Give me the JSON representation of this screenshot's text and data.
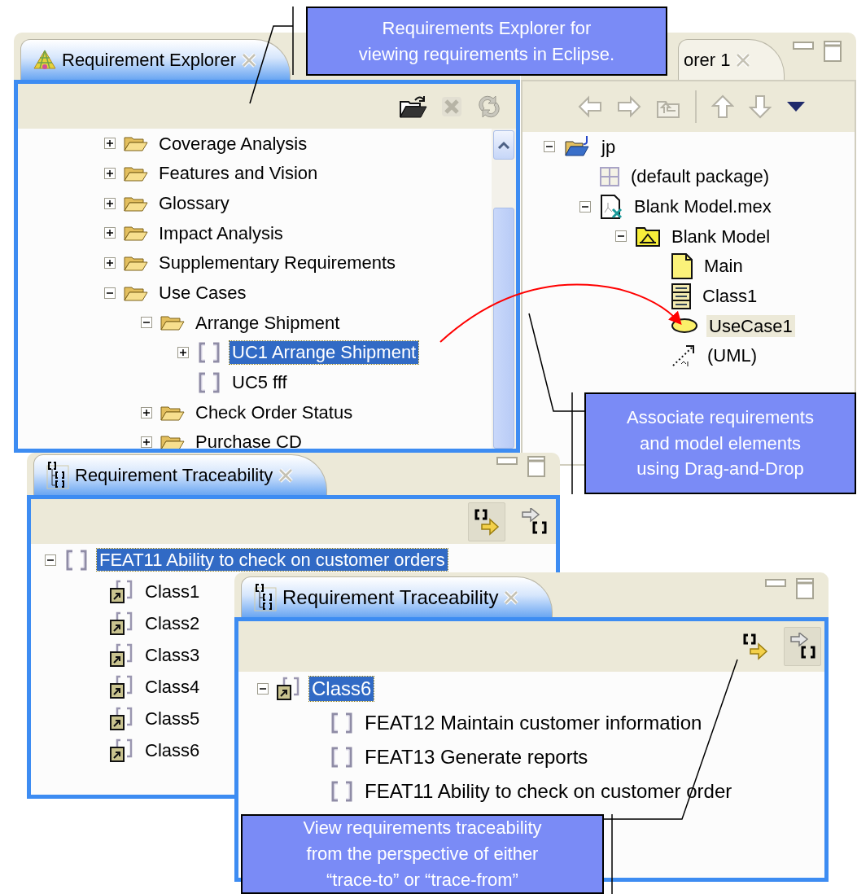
{
  "requirement_explorer": {
    "title": "Requirement Explorer",
    "active": true,
    "tree": [
      {
        "label": "Coverage Analysis",
        "kind": "folder",
        "expanded": false,
        "selected": false
      },
      {
        "label": "Features and Vision",
        "kind": "folder",
        "expanded": false,
        "selected": false
      },
      {
        "label": "Glossary",
        "kind": "folder",
        "expanded": false,
        "selected": false
      },
      {
        "label": "Impact Analysis",
        "kind": "folder",
        "expanded": false,
        "selected": false
      },
      {
        "label": "Supplementary Requirements",
        "kind": "folder",
        "expanded": false,
        "selected": false
      },
      {
        "label": "Use Cases",
        "kind": "folder",
        "expanded": true,
        "selected": false,
        "children": [
          {
            "label": "Arrange Shipment",
            "kind": "folder",
            "expanded": true,
            "selected": false,
            "children": [
              {
                "label": "UC1 Arrange Shipment",
                "kind": "requirement",
                "expanded": false,
                "selected": true
              },
              {
                "label": "UC5 fff",
                "kind": "requirement",
                "selected": false
              }
            ]
          },
          {
            "label": "Check Order Status",
            "kind": "folder",
            "expanded": false,
            "selected": false
          },
          {
            "label": "Purchase CD",
            "kind": "folder",
            "expanded": false,
            "selected": false
          }
        ]
      }
    ]
  },
  "package_explorer": {
    "title": "orer 1",
    "active": false,
    "tree": [
      {
        "label": "jp",
        "kind": "package-root",
        "expanded": true,
        "selected": false,
        "drop_target": false,
        "children": [
          {
            "label": "(default package)",
            "kind": "package",
            "selected": false,
            "drop_target": false
          },
          {
            "label": "Blank Model.mex",
            "kind": "model-file",
            "expanded": true,
            "selected": false,
            "drop_target": false,
            "children": [
              {
                "label": "Blank Model",
                "kind": "model",
                "expanded": true,
                "selected": false,
                "drop_target": false,
                "children": [
                  {
                    "label": "Main",
                    "kind": "diagram",
                    "selected": false,
                    "drop_target": false
                  },
                  {
                    "label": "Class1",
                    "kind": "class",
                    "selected": false,
                    "drop_target": false
                  },
                  {
                    "label": "UseCase1",
                    "kind": "use-case",
                    "selected": false,
                    "drop_target": true
                  },
                  {
                    "label": "(UML)",
                    "kind": "uml",
                    "selected": false,
                    "drop_target": false
                  }
                ]
              }
            ]
          }
        ]
      }
    ]
  },
  "traceability_views": [
    {
      "title": "Requirement Traceability",
      "active": true,
      "buttons": [
        {
          "kind": "trace-to",
          "pressed": true
        },
        {
          "kind": "trace-from",
          "pressed": false
        }
      ],
      "tree": [
        {
          "label": "FEAT11 Ability to check on customer orders",
          "kind": "requirement",
          "expanded": true,
          "selected": true,
          "children": [
            {
              "label": "Class1",
              "kind": "class-link",
              "selected": false
            },
            {
              "label": "Class2",
              "kind": "class-link",
              "selected": false
            },
            {
              "label": "Class3",
              "kind": "class-link",
              "selected": false
            },
            {
              "label": "Class4",
              "kind": "class-link",
              "selected": false
            },
            {
              "label": "Class5",
              "kind": "class-link",
              "selected": false
            },
            {
              "label": "Class6",
              "kind": "class-link",
              "selected": false
            }
          ]
        }
      ]
    },
    {
      "title": "Requirement Traceability",
      "active": true,
      "buttons": [
        {
          "kind": "trace-to",
          "pressed": false
        },
        {
          "kind": "trace-from",
          "pressed": true
        }
      ],
      "tree": [
        {
          "label": "Class6",
          "kind": "class-link",
          "expanded": true,
          "selected": true,
          "children": [
            {
              "label": "FEAT12 Maintain customer information",
              "kind": "requirement",
              "selected": false
            },
            {
              "label": "FEAT13 Generate reports",
              "kind": "requirement",
              "selected": false
            },
            {
              "label": "FEAT11 Ability to check on customer order",
              "kind": "requirement",
              "selected": false
            }
          ]
        }
      ]
    }
  ],
  "callouts": [
    {
      "text": "Requirements Explorer for\nviewing requirements in Eclipse."
    },
    {
      "text": "Associate requirements\nand model elements\nusing Drag-and-Drop"
    },
    {
      "text": "View requirements traceability\nfrom the perspective of either\n“trace-to” or “trace-from”"
    }
  ]
}
